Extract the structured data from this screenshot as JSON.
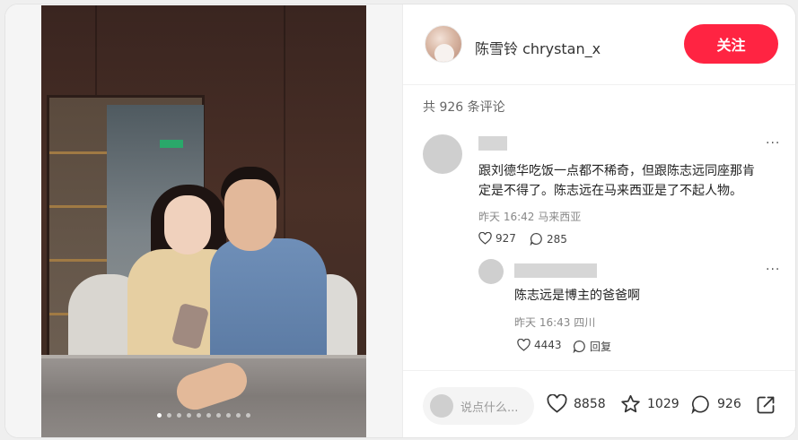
{
  "post": {
    "image_count": 10,
    "image_index": 1
  },
  "author": {
    "name": "陈雪铃 chrystan_x",
    "follow_label": "关注"
  },
  "comments_header": "共 926 条评论",
  "comments": [
    {
      "text_line1": "跟刘德华吃饭一点都不稀奇，但跟陈志远同座那肯",
      "text_line2": "定是不得了。陈志远在马来西亚是了不起人物。",
      "meta": "昨天 16:42 马来西亚",
      "likes": "927",
      "replies": "285",
      "more": "···"
    },
    {
      "text": "陈志远是博主的爸爸啊",
      "meta": "昨天 16:43 四川",
      "likes": "4443",
      "reply_label": "回复",
      "more": "···"
    }
  ],
  "bottom": {
    "input_placeholder": "说点什么...",
    "likes": "8858",
    "collects": "1029",
    "comments": "926"
  },
  "colors": {
    "accent": "#ff2442"
  },
  "icons": {
    "like": "heart-icon",
    "collect": "star-icon",
    "comment": "comment-bubble-icon",
    "share": "share-icon",
    "more": "more-dots-icon"
  }
}
